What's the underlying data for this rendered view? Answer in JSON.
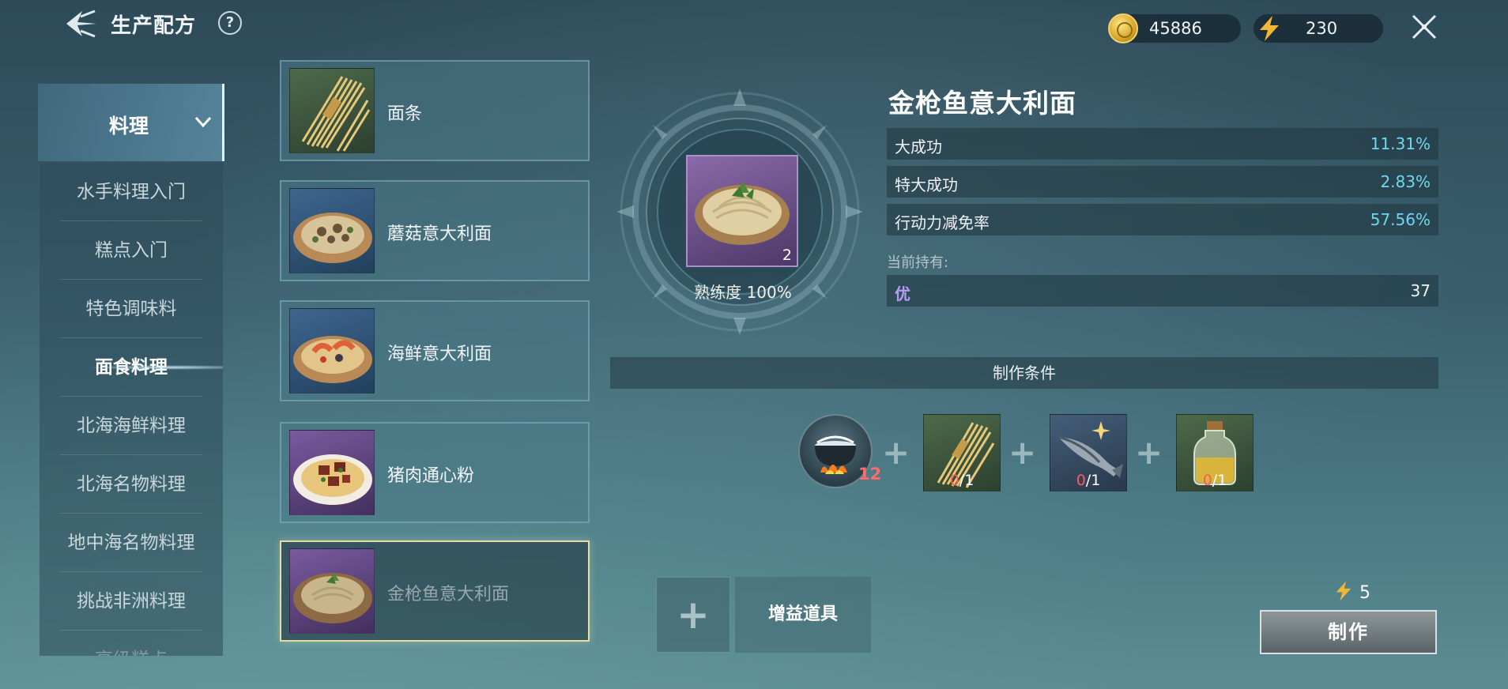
{
  "header": {
    "title": "生产配方",
    "help_label": "?",
    "gold": "45886",
    "energy": "230"
  },
  "nav": {
    "selected_category": "料理",
    "items": [
      {
        "label": "水手料理入门"
      },
      {
        "label": "糕点入门"
      },
      {
        "label": "特色调味料"
      },
      {
        "label": "面食料理"
      },
      {
        "label": "北海海鲜料理"
      },
      {
        "label": "北海名物料理"
      },
      {
        "label": "地中海名物料理"
      },
      {
        "label": "挑战非洲料理"
      },
      {
        "label": "高级糕点"
      }
    ]
  },
  "recipes": [
    {
      "name": "面条"
    },
    {
      "name": "蘑菇意大利面"
    },
    {
      "name": "海鲜意大利面"
    },
    {
      "name": "猪肉通心粉"
    },
    {
      "name": "金枪鱼意大利面"
    }
  ],
  "product": {
    "count": "2",
    "proficiency": "熟练度 100%"
  },
  "detail": {
    "title": "金枪鱼意大利面",
    "stats": [
      {
        "label": "大成功",
        "value": "11.31%"
      },
      {
        "label": "特大成功",
        "value": "2.83%"
      },
      {
        "label": "行动力减免率",
        "value": "57.56%"
      }
    ],
    "holding_label": "当前持有:",
    "holding": {
      "quality": "优",
      "count": "37"
    }
  },
  "conditions": {
    "title": "制作条件",
    "tool_count": "12",
    "ingredients": [
      {
        "have": "0",
        "need": "/1"
      },
      {
        "have": "0",
        "need": "/1"
      },
      {
        "have": "0",
        "need": "/1"
      }
    ]
  },
  "actions": {
    "add_symbol": "+",
    "boost_label": "增益道具",
    "cost": "5",
    "make_label": "制作"
  },
  "colors": {
    "accent_cyan": "#6fd8f0",
    "missing_red": "#ff5b5b",
    "quality_purple": "#b89cf0",
    "selected_border": "#e6dca8"
  }
}
